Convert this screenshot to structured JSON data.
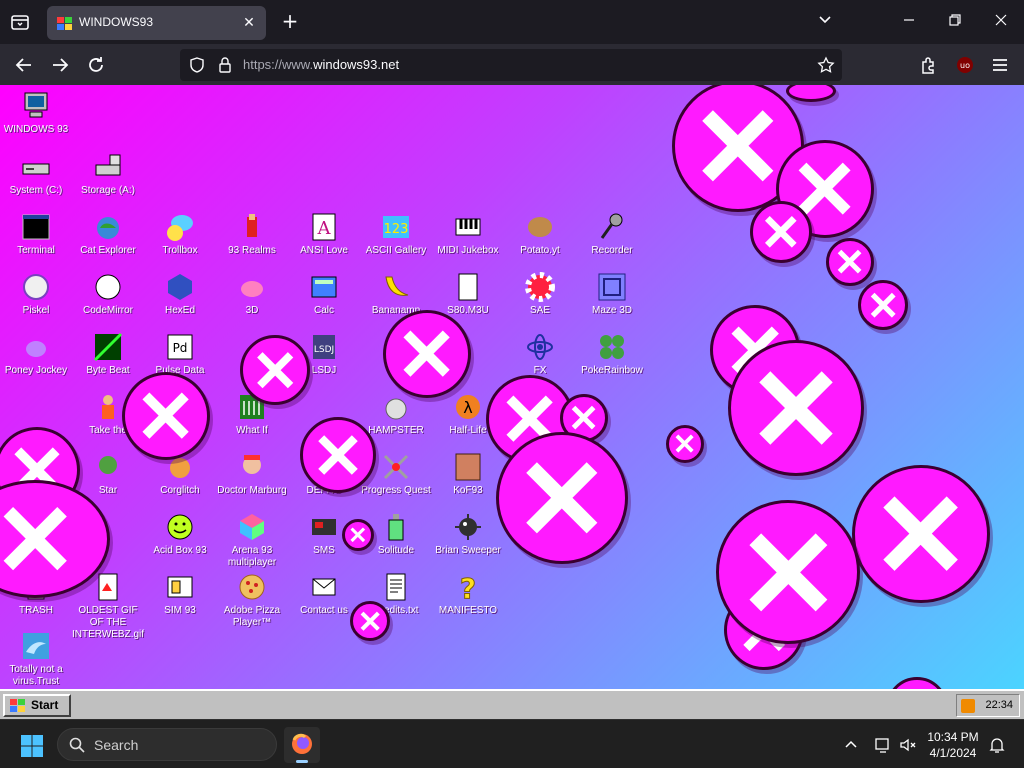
{
  "browser": {
    "tab_title": "WINDOWS93",
    "url_prefix": "https://www.",
    "url_domain": "windows93.net"
  },
  "desktop": {
    "icons": [
      {
        "label": "WINDOWS 93",
        "icon": "computer-icon"
      },
      {
        "label": "System (C:)",
        "icon": "drive-icon"
      },
      {
        "label": "Storage (A:)",
        "icon": "floppy-drive-icon"
      },
      {
        "label": "Terminal",
        "icon": "terminal-icon"
      },
      {
        "label": "Cat Explorer",
        "icon": "cat-globe-icon"
      },
      {
        "label": "Trollbox",
        "icon": "troll-chat-icon"
      },
      {
        "label": "93 Realms",
        "icon": "knight-icon"
      },
      {
        "label": "ANSI Love",
        "icon": "letter-a-icon"
      },
      {
        "label": "ASCII Gallery",
        "icon": "ascii-123-icon"
      },
      {
        "label": "MIDI Jukebox",
        "icon": "piano-icon"
      },
      {
        "label": "Potato.yt",
        "icon": "potato-icon"
      },
      {
        "label": "Recorder",
        "icon": "microphone-icon"
      },
      {
        "label": "Piskel",
        "icon": "hand-icon"
      },
      {
        "label": "CodeMirror",
        "icon": "codemirror-icon"
      },
      {
        "label": "HexEd",
        "icon": "cube-icon"
      },
      {
        "label": "3D",
        "icon": "teapot-icon"
      },
      {
        "label": "Calc",
        "icon": "calculator-icon"
      },
      {
        "label": "Bananamp",
        "icon": "banana-icon"
      },
      {
        "label": "S80.M3U",
        "icon": "music-file-icon"
      },
      {
        "label": "SAE",
        "icon": "checker-ball-icon"
      },
      {
        "label": "Maze 3D",
        "icon": "maze-icon"
      },
      {
        "label": "Poney Jockey",
        "icon": "pony-icon"
      },
      {
        "label": "Byte Beat",
        "icon": "bytebeat-icon"
      },
      {
        "label": "Pulse Data",
        "icon": "pd-icon"
      },
      {
        "label": "LSDJ",
        "icon": "lsdj-icon"
      },
      {
        "label": "FX",
        "icon": "atom-icon"
      },
      {
        "label": "PokeRainbow",
        "icon": "poke-icon"
      },
      {
        "label": "Take the",
        "icon": "man-icon"
      },
      {
        "label": "What If",
        "icon": "whatif-icon"
      },
      {
        "label": "HAMPSTER",
        "icon": "hamster-icon"
      },
      {
        "label": "Half-Life",
        "icon": "half-life-icon"
      },
      {
        "label": "Star",
        "icon": "yoda-icon"
      },
      {
        "label": "Corglitch",
        "icon": "corgi-icon"
      },
      {
        "label": "Doctor Marburg",
        "icon": "doctor-icon"
      },
      {
        "label": "DEFRG",
        "icon": "defrag-icon"
      },
      {
        "label": "Progress Quest",
        "icon": "swords-icon"
      },
      {
        "label": "KoF93",
        "icon": "fighter-icon"
      },
      {
        "label": "Acid Box 93",
        "icon": "smiley-icon"
      },
      {
        "label": "Arena 93 multiplayer",
        "icon": "arena-cube-icon"
      },
      {
        "label": "SMS",
        "icon": "sms-icon"
      },
      {
        "label": "Solitude",
        "icon": "bottle-icon"
      },
      {
        "label": "Brian Sweeper",
        "icon": "mine-icon"
      },
      {
        "label": "TRASH",
        "icon": "trash-icon"
      },
      {
        "label": "OLDEST GIF OF THE INTERWEBZ.gif",
        "icon": "gif-file-icon"
      },
      {
        "label": "SIM 93",
        "icon": "sim-card-icon"
      },
      {
        "label": "Adobe Pizza Player™",
        "icon": "pizza-icon"
      },
      {
        "label": "Contact us",
        "icon": "contact-icon"
      },
      {
        "label": "Credits.txt",
        "icon": "text-file-icon"
      },
      {
        "label": "MANIFESTO",
        "icon": "question-mark-icon"
      },
      {
        "label": "Totally not a virus.Trust",
        "icon": "dolphin-icon"
      }
    ]
  },
  "win93_taskbar": {
    "start_label": "Start",
    "tray_time": "22:34"
  },
  "os_taskbar": {
    "search_label": "Search",
    "time": "10:34 PM",
    "date": "4/1/2024"
  },
  "colors": {
    "accent_magenta": "#ff1aff",
    "browser_bg": "#1c1b22",
    "toolbar_bg": "#2b2a33"
  }
}
